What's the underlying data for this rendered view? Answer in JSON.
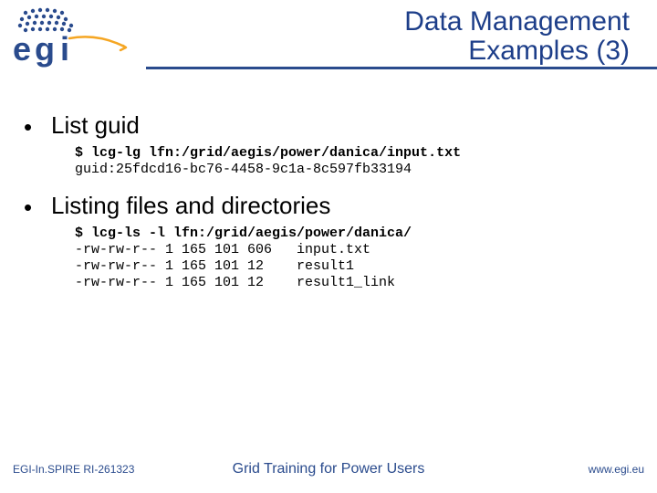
{
  "header": {
    "title_line1": "Data Management",
    "title_line2": "Examples (3)"
  },
  "bullets": [
    {
      "heading": "List guid",
      "command": "$ lcg-lg lfn:/grid/aegis/power/danica/input.txt",
      "output": "guid:25fdcd16-bc76-4458-9c1a-8c597fb33194"
    },
    {
      "heading": "Listing files and directories",
      "command": "$ lcg-ls -l lfn:/grid/aegis/power/danica/",
      "output": "-rw-rw-r-- 1 165 101 606   input.txt\n-rw-rw-r-- 1 165 101 12    result1\n-rw-rw-r-- 1 165 101 12    result1_link"
    }
  ],
  "footer": {
    "left": "EGI-In.SPIRE RI-261323",
    "center": "Grid Training for Power Users",
    "right": "www.egi.eu"
  },
  "logo": {
    "text": "egi"
  }
}
